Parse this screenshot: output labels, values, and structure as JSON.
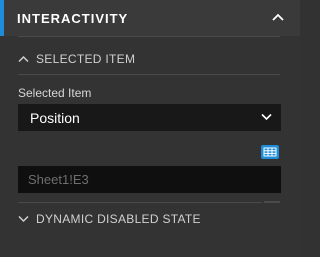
{
  "panel": {
    "title": "INTERACTIVITY",
    "accent_color": "#1e8cd7"
  },
  "selected_item_section": {
    "title": "SELECTED ITEM",
    "expanded": true,
    "field_label": "Selected Item",
    "select_value": "Position",
    "cell_reference": "Sheet1!E3"
  },
  "dynamic_disabled_section": {
    "title": "DYNAMIC DISABLED STATE",
    "expanded": false
  },
  "icons": {
    "header_toggle": "chevron-up-icon",
    "section_toggle_open": "chevron-up-icon",
    "section_toggle_closed": "chevron-down-icon",
    "select_dropdown": "chevron-down-icon",
    "cell_picker": "table-icon"
  }
}
